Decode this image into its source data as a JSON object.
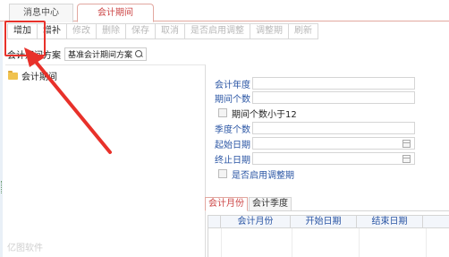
{
  "tabs": {
    "message_center": "消息中心",
    "accounting_period": "会计期间"
  },
  "toolbar": {
    "add": "增加",
    "supplement": "增补",
    "modify": "修改",
    "delete": "删除",
    "save": "保存",
    "cancel": "取消",
    "enable_adjust": "是否启用调整",
    "adjust_period": "调整期",
    "refresh": "刷新"
  },
  "scheme": {
    "label": "会计期间方案",
    "selected": "基准会计期间方案"
  },
  "tree": {
    "root_label": "会计期间"
  },
  "form": {
    "fiscal_year_label": "会计年度",
    "fiscal_year_value": "",
    "period_count_label": "期间个数",
    "period_count_value": "",
    "less_than_12_label": "期间个数小于12",
    "quarter_count_label": "季度个数",
    "quarter_count_value": "",
    "start_date_label": "起始日期",
    "start_date_value": "",
    "end_date_label": "终止日期",
    "end_date_value": "",
    "enable_adjust_label": "是否启用调整期"
  },
  "bottom_tabs": {
    "month": "会计月份",
    "season": "会计季度"
  },
  "grid": {
    "columns": [
      "会计月份",
      "开始日期",
      "结束日期"
    ],
    "rows": []
  },
  "watermark": "亿图软件",
  "colors": {
    "accent_red": "#e8312a",
    "label_blue": "#2a55a4",
    "tab_active": "#c44444"
  }
}
